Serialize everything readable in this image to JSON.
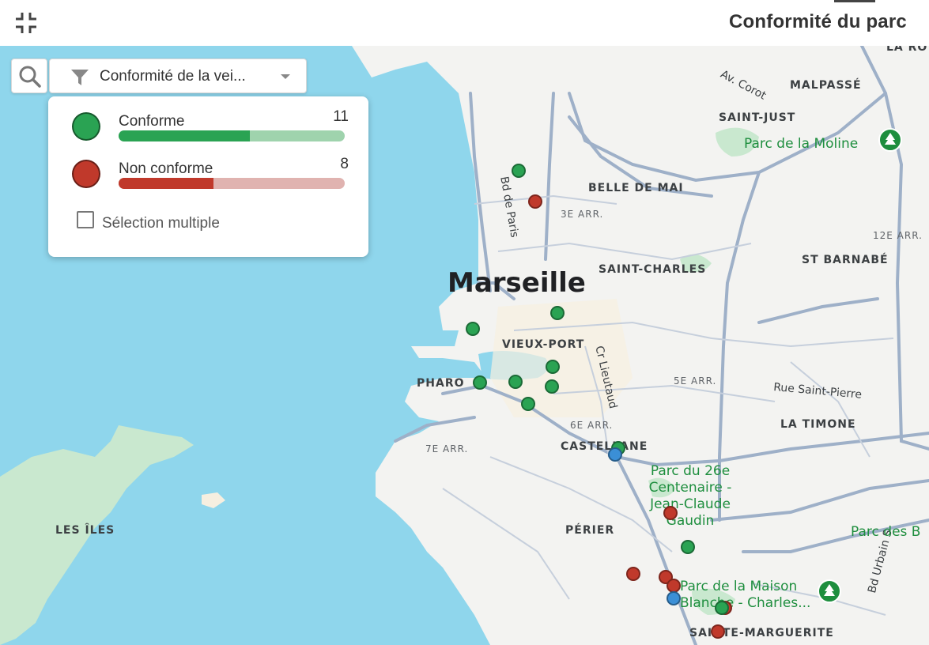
{
  "header": {
    "title": "Conformité du parc",
    "exit_fullscreen_icon": "exit-fullscreen-icon"
  },
  "toolbar": {
    "search_icon": "search-icon",
    "filter_icon": "funnel-icon",
    "filter_label": "Conformité de la vei..."
  },
  "legend": {
    "items": [
      {
        "label": "Conforme",
        "count": "11",
        "color": "#2aa353",
        "track": "#9fd3ad",
        "fraction": 0.58
      },
      {
        "label": "Non conforme",
        "count": "8",
        "color": "#c0392b",
        "track": "#e0b3b0",
        "fraction": 0.42
      }
    ],
    "multi_select_label": "Sélection multiple"
  },
  "map": {
    "city": "Marseille",
    "districts": [
      "BELLE DE MAI",
      "SAINT-JUST",
      "MALPASSÉ",
      "SAINT-CHARLES",
      "ST BARNABÉ",
      "VIEUX-PORT",
      "PHARO",
      "LA TIMONE",
      "CASTELLANE",
      "PÉRIER",
      "LES ÎLES",
      "SAINTE-MARGUERITE",
      "LA RO"
    ],
    "arrondissements": [
      "3E ARR.",
      "12E ARR.",
      "5E ARR.",
      "6E ARR.",
      "7E ARR."
    ],
    "streets": [
      "Av. Corot",
      "Bd de Paris",
      "Cr Lieutaud",
      "Rue Saint-Pierre",
      "Bd Urbain S"
    ],
    "parks": [
      "Parc de la Moline",
      "Parc du 26e Centenaire - Jean-Claude Gaudin",
      "Parc des B",
      "Parc de la Maison Blanche - Charles..."
    ],
    "colors": {
      "sea": "#8fd6ec",
      "land": "#f3f3f1",
      "park": "#c9e8cf",
      "road": "#9eb0c8",
      "conforme": "#2aa353",
      "non_conforme": "#c0392b",
      "other": "#3b8fd6"
    }
  }
}
